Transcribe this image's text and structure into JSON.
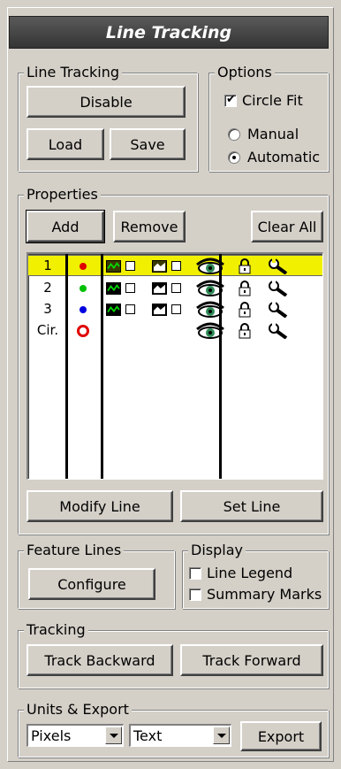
{
  "title": "Line Tracking",
  "line_tracking": {
    "legend": "Line Tracking",
    "disable_label": "Disable",
    "load_label": "Load",
    "save_label": "Save"
  },
  "options": {
    "legend": "Options",
    "circle_fit": {
      "label": "Circle Fit",
      "checked": true
    },
    "mode": {
      "options": [
        "Manual",
        "Automatic"
      ],
      "selected": "Automatic"
    }
  },
  "properties": {
    "legend": "Properties",
    "add_label": "Add",
    "remove_label": "Remove",
    "clear_all_label": "Clear All",
    "rows": [
      {
        "label": "1",
        "color": "#e00000",
        "selected": true,
        "marker": "dot"
      },
      {
        "label": "2",
        "color": "#00c000",
        "selected": false,
        "marker": "dot"
      },
      {
        "label": "3",
        "color": "#0000e0",
        "selected": false,
        "marker": "dot"
      },
      {
        "label": "Cir.",
        "color": "#e00000",
        "selected": false,
        "marker": "ring"
      }
    ],
    "row_icons": [
      "line-graph-icon",
      "checkbox",
      "area-graph-icon",
      "checkbox",
      "eye-icon",
      "lock-icon",
      "wrench-icon"
    ],
    "modify_line_label": "Modify Line",
    "set_line_label": "Set Line"
  },
  "feature_lines": {
    "legend": "Feature Lines",
    "configure_label": "Configure"
  },
  "display": {
    "legend": "Display",
    "line_legend": {
      "label": "Line Legend",
      "checked": false
    },
    "summary_marks": {
      "label": "Summary Marks",
      "checked": false
    }
  },
  "tracking": {
    "legend": "Tracking",
    "backward_label": "Track Backward",
    "forward_label": "Track Forward"
  },
  "units_export": {
    "legend": "Units & Export",
    "units_value": "Pixels",
    "format_value": "Text",
    "export_label": "Export"
  }
}
